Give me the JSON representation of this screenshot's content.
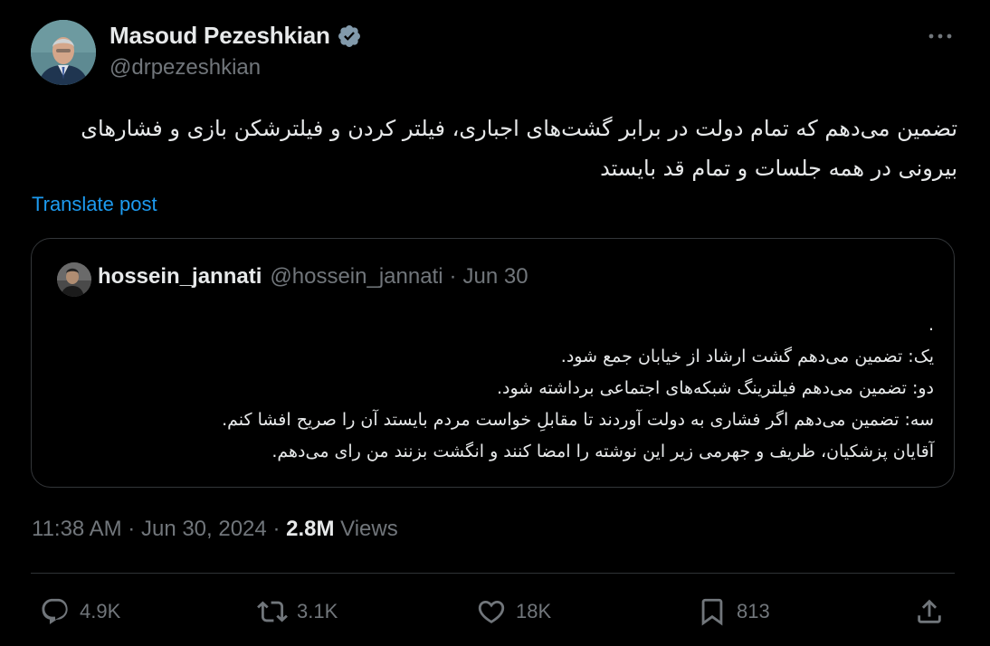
{
  "author": {
    "display_name": "Masoud Pezeshkian",
    "handle": "@drpezeshkian",
    "verified_icon": "verified-badge-icon"
  },
  "post": {
    "text_lines": [
      "تضمین می‌دهم که تمام دولت در برابر  گشت‌های اجباری، فیلتر کردن و فیلترشکن بازی و فشارهای",
      "بیرونی در همه جلسات و تمام قد بایستد"
    ],
    "translate_label": "Translate post"
  },
  "quote": {
    "name": "hossein_jannati",
    "handle": "@hossein_jannati",
    "separator": "·",
    "date": "Jun 30",
    "lines": [
      ".",
      "یک: تضمین می‌دهم گشت ارشاد از خیابان جمع شود.",
      "دو: تضمین می‌دهم فیلترینگ شبکه‌های اجتماعی برداشته شود.",
      "سه: تضمین می‌دهم اگر فشاری به دولت آوردند تا مقابلِ خواست مردم بایستد آن را صریح افشا کنم.",
      "آقایان پزشکیان، ظریف و جهرمی زیر این نوشته را امضا کنند و انگشت بزنند من رای می‌دهم."
    ]
  },
  "meta": {
    "time": "11:38 AM",
    "separator1": "·",
    "date": "Jun 30, 2024",
    "separator2": "·",
    "views_count": "2.8M",
    "views_label": "Views"
  },
  "actions": {
    "reply": "4.9K",
    "repost": "3.1K",
    "like": "18K",
    "bookmark": "813"
  },
  "colors": {
    "background": "#000000",
    "text": "#e7e9ea",
    "secondary": "#71767b",
    "link": "#1d9bf0",
    "verified": "#829aab",
    "border": "#2f3336"
  }
}
